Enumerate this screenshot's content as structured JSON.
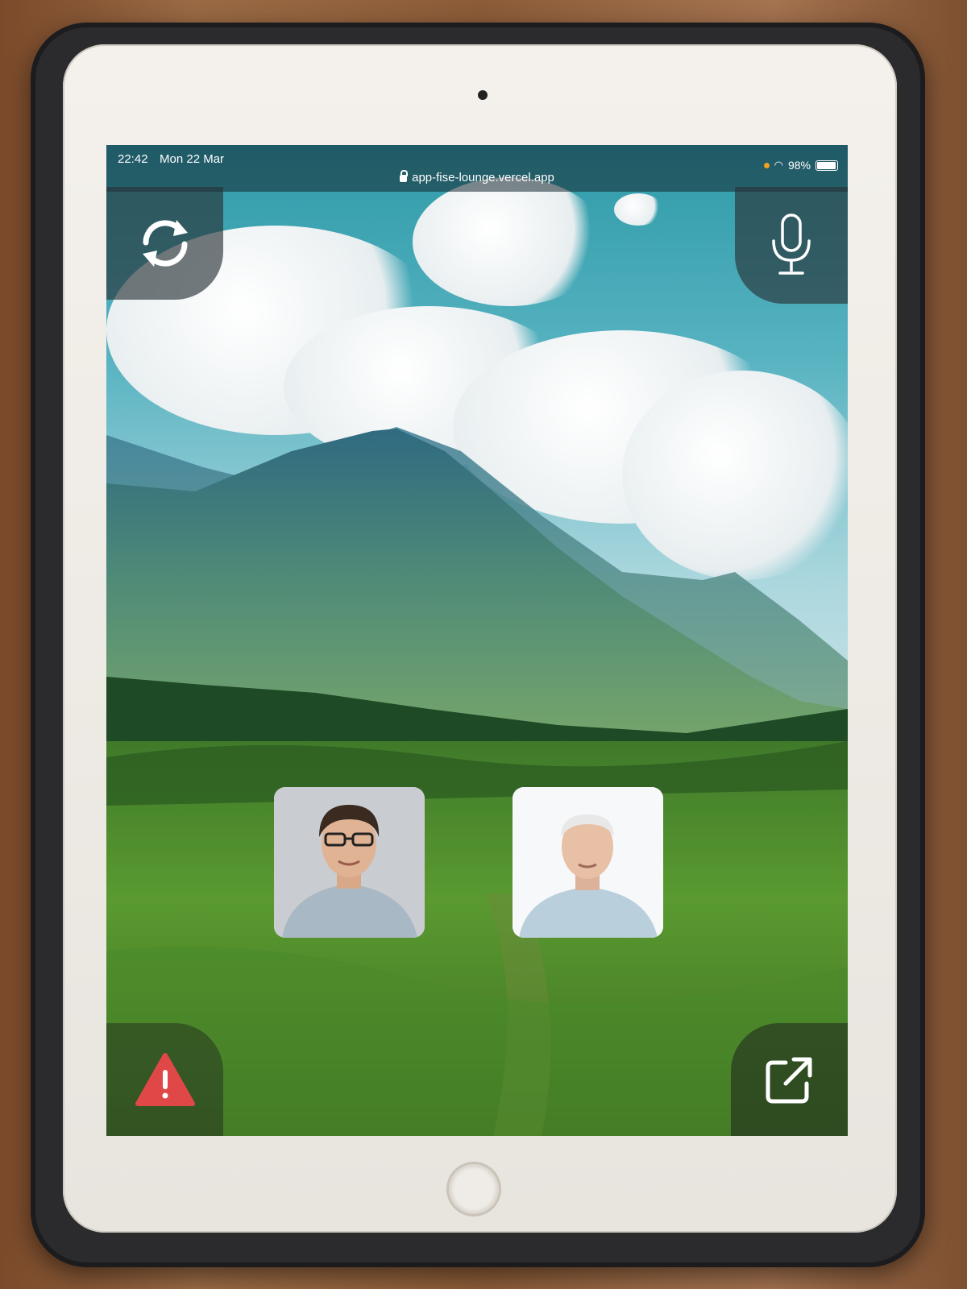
{
  "status_bar": {
    "time": "22:42",
    "date": "Mon 22 Mar",
    "url": "app-fise-lounge.vercel.app",
    "battery": "98%"
  },
  "controls": {
    "top_left_icon": "switch-camera-icon",
    "top_right_icon": "microphone-icon",
    "bottom_left_icon": "warning-icon",
    "bottom_right_icon": "open-external-icon",
    "warning_color": "#e04848"
  },
  "participants": [
    {
      "icon": "user-avatar-young-man-glasses"
    },
    {
      "icon": "user-avatar-older-man"
    }
  ]
}
